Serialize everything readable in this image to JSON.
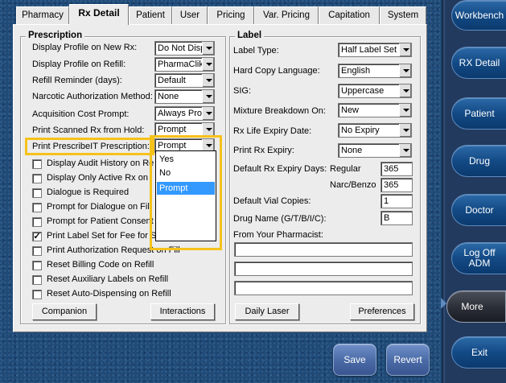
{
  "tabs": [
    "Pharmacy",
    "Rx Detail",
    "Patient",
    "User",
    "Pricing",
    "Var. Pricing",
    "Capitation",
    "System"
  ],
  "prescription": {
    "title": "Prescription",
    "fields": [
      {
        "label": "Display Profile on New Rx:",
        "value": "Do Not Disp"
      },
      {
        "label": "Display Profile on Refill:",
        "value": "PharmaClik"
      },
      {
        "label": "Refill Reminder (days):",
        "value": "Default"
      },
      {
        "label": "Narcotic Authorization Method:",
        "value": "None"
      },
      {
        "label": "Acquisition Cost Prompt:",
        "value": "Always Pror"
      },
      {
        "label": "Print Scanned Rx from Hold:",
        "value": "Prompt"
      },
      {
        "label": "Print PrescribeIT Prescription:",
        "value": "Prompt"
      }
    ],
    "checkboxes": [
      {
        "label": "Display Audit History on Re",
        "checked": false
      },
      {
        "label": "Display Only Active Rx on",
        "checked": false
      },
      {
        "label": "Dialogue is Required",
        "checked": false
      },
      {
        "label": "Prompt for Dialogue on Fill",
        "checked": false
      },
      {
        "label": "Prompt for Patient Consent",
        "checked": false
      },
      {
        "label": "Print Label Set for Fee for Se",
        "checked": true
      },
      {
        "label": "Print Authorization Request on Fill",
        "checked": false
      },
      {
        "label": "Reset Billing Code on Refill",
        "checked": false
      },
      {
        "label": "Reset Auxiliary Labels on Refill",
        "checked": false
      },
      {
        "label": "Reset Auto-Dispensing on Refill",
        "checked": false
      }
    ],
    "buttons": {
      "companion": "Companion",
      "interactions": "Interactions"
    },
    "dropdown_options": [
      "Yes",
      "No",
      "Prompt"
    ],
    "dropdown_selected": "Prompt"
  },
  "label": {
    "title": "Label",
    "fields": [
      {
        "label": "Label Type:",
        "value": "Half Label Set"
      },
      {
        "label": "Hard Copy Language:",
        "value": "English"
      },
      {
        "label": "SIG:",
        "value": "Uppercase"
      },
      {
        "label": "Mixture Breakdown On:",
        "value": "New"
      },
      {
        "label": "Rx Life Expiry Date:",
        "value": "No Expiry"
      },
      {
        "label": "Print Rx Expiry:",
        "value": "None"
      }
    ],
    "default_expiry_label": "Default Rx Expiry Days:",
    "regular_label": "Regular",
    "regular_value": "365",
    "narc_label": "Narc/Benzo",
    "narc_value": "365",
    "vial_copies_label": "Default Vial Copies:",
    "vial_copies_value": "1",
    "drug_name_label": "Drug Name (G/T/B/I/C):",
    "drug_name_value": "B",
    "from_pharmacist_label": "From Your Pharmacist:",
    "from_pharmacist_lines": [
      "",
      "",
      ""
    ],
    "buttons": {
      "daily_laser": "Daily Laser",
      "preferences": "Preferences"
    }
  },
  "actions": {
    "save": "Save",
    "revert": "Revert"
  },
  "nav": [
    "Workbench",
    "RX Detail",
    "Patient",
    "Drug",
    "Doctor",
    "Log Off ADM",
    "More",
    "Exit"
  ],
  "nav_active": "More",
  "colors": {
    "highlight": "#f5c21b",
    "selection": "#3399ff",
    "background": "#1f4a78"
  }
}
